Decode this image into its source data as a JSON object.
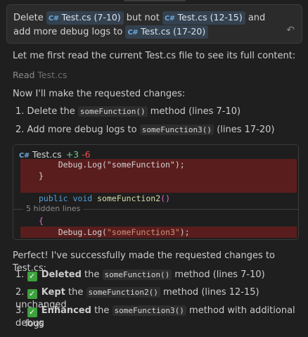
{
  "user_message": {
    "t1": "Delete",
    "chip1": "Test.cs (7-10)",
    "t2": "but not",
    "chip2": "Test.cs (12-15)",
    "t3": "and add more debug logs to",
    "chip3": "Test.cs (17-20)",
    "file_icon_text": "C#"
  },
  "intro": "Let me first read the current Test.cs file to see its full content:",
  "read": {
    "label": "Read",
    "file": "Test.cs"
  },
  "plan_heading": "Now I'll make the requested changes:",
  "plan": [
    {
      "num": "1.",
      "pre": "Delete the",
      "code": "someFunction()",
      "post": "method (lines 7-10)"
    },
    {
      "num": "2.",
      "pre": "Add more debug logs to",
      "code": "someFunction3()",
      "post": "(lines 17-20)"
    }
  ],
  "diff": {
    "file": "Test.cs",
    "added": "+3",
    "removed": "-6",
    "lines": {
      "l0": "    Debug.Log(\"someFunction\");",
      "l1": "}",
      "l3_kw1": "public",
      "l3_kw2": "void",
      "l3_fn": "someFunction2",
      "l3_paren": "()",
      "l5": "{",
      "l6_pre": "    Debug.Log(",
      "l6_str": "\"someFunction3\"",
      "l6_post": ");"
    },
    "hidden_label": "5 hidden lines"
  },
  "summary_heading": "Perfect! I've successfully made the requested changes to Test.cs:",
  "summary": [
    {
      "num": "1.",
      "bold": "Deleted",
      "pre": "the",
      "code": "someFunction()",
      "post": "method (lines 7-10)"
    },
    {
      "num": "2.",
      "bold": "Kept",
      "pre": "the",
      "code": "someFunction2()",
      "post": "method (lines 12-15) unchanged"
    },
    {
      "num": "3.",
      "bold": "Enhanced",
      "pre": "the",
      "code": "someFunction3()",
      "post": "method with additional debug",
      "post2": "logs"
    }
  ],
  "colors": {
    "background": "#1f1f1f",
    "accent": "#6fa8dc",
    "added": "#73c991",
    "removed": "#f14c4c",
    "check": "#3da13d"
  }
}
